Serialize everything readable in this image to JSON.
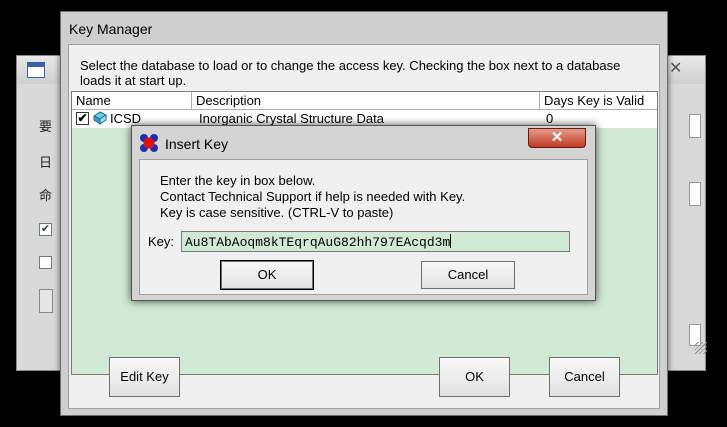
{
  "background_window": {
    "glyphs": [
      "要",
      "日",
      "命"
    ],
    "checkboxes": [
      {
        "checked": true
      },
      {
        "checked": false
      }
    ],
    "close_glyph": "✕"
  },
  "key_manager": {
    "title": "Key Manager",
    "instructions": "Select the database to load or to change the access key.  Checking the box next to a database loads it at start up.",
    "columns": [
      "Name",
      "Description",
      "Days Key is Valid"
    ],
    "rows": [
      {
        "checked": true,
        "name": "ICSD",
        "description": "Inorganic Crystal Structure Data",
        "days": "0"
      }
    ],
    "buttons": {
      "edit_key": "Edit Key",
      "ok": "OK",
      "cancel": "Cancel"
    }
  },
  "insert_key": {
    "title": "Insert Key",
    "close_label": "✕",
    "message_lines": [
      "Enter the key in box below.",
      "Contact Technical Support if help is needed with Key.",
      "Key is case sensitive.  (CTRL-V to paste)"
    ],
    "key_label": "Key:",
    "key_value": "Au8TAbAoqm8kTEqrqAuG82hh797EAcqd3m",
    "buttons": {
      "ok": "OK",
      "cancel": "Cancel"
    }
  },
  "colors": {
    "list_bg": "#d0ead5",
    "close_red": "#c23a22"
  }
}
